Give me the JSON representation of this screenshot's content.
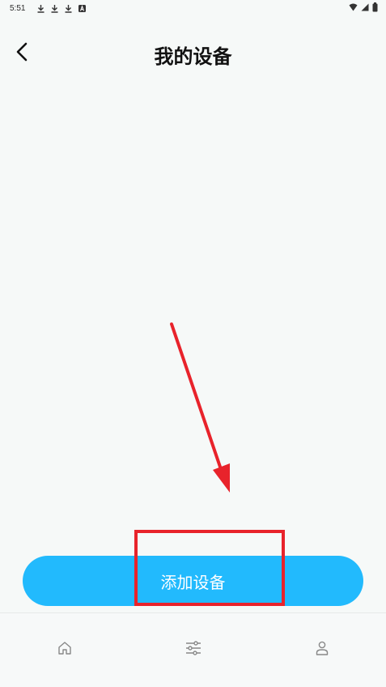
{
  "status_bar": {
    "time": "5:51",
    "notification_icons": [
      "download-icon",
      "download-icon",
      "download-icon",
      "app-a-icon"
    ],
    "right_icons": [
      "wifi-icon",
      "signal-icon",
      "battery-icon"
    ]
  },
  "header": {
    "title": "我的设备",
    "back_icon": "chevron-left-icon"
  },
  "main": {
    "add_device_label": "添加设备"
  },
  "bottom_nav": {
    "items": [
      {
        "icon": "home-icon"
      },
      {
        "icon": "sliders-icon"
      },
      {
        "icon": "user-icon"
      }
    ]
  },
  "colors": {
    "background": "#f6f9f8",
    "accent": "#22bafd",
    "annotation": "#e8232b",
    "icon": "#888888"
  }
}
